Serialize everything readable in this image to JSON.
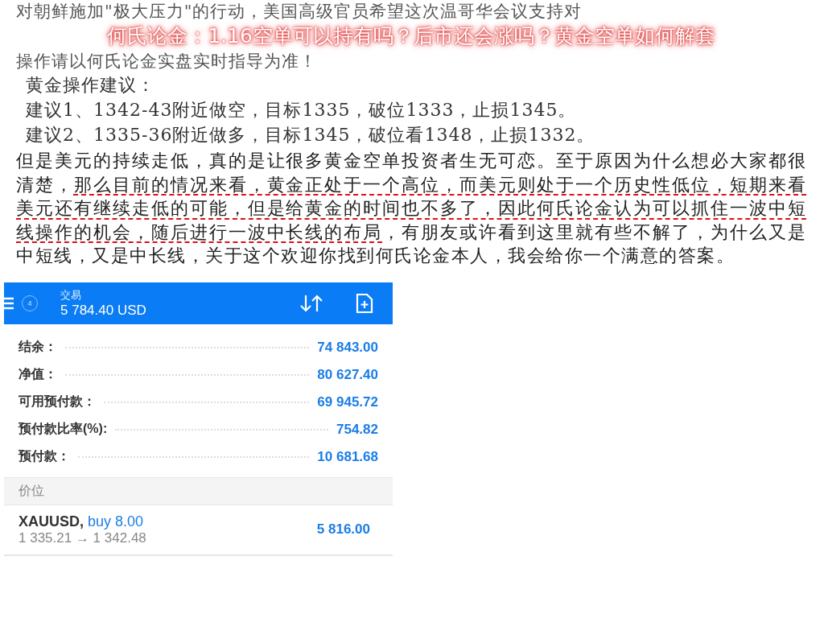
{
  "article": {
    "top_line": "对朝鲜施加\"极大压力\"的行动，美国高级官员希望这次温哥华会议支持对",
    "headline": "何氏论金：1.16空单可以持有吗？后市还会涨吗？黄金空单如何解套",
    "notice_line": "操作请以何氏论金实盘实时指导为准！",
    "advice_title": "黄金操作建议：",
    "advice": [
      "建议1、1342-43附近做空，目标1335，破位1333，止损1345。",
      "建议2、1335-36附近做多，目标1345，破位看1348，止损1332。"
    ],
    "paragraph": [
      {
        "text": "但是美元的持续走低，真的是让很多黄金空单投资者生无可恋。至于原因为什么想必大家都很清楚，",
        "underlined": false
      },
      {
        "text": "那么目前的情况来看，黄金正处于一个高位，而美元则处于一个历史性低位，短期来看美元还有继续走低的可能，但是给黄金的时间也不多了，因此何氏论金认为可以抓住一波中短线操作的机会，随后进行一波中长线的布局",
        "underlined": true
      },
      {
        "text": "，有朋友或许看到这里就有些不解了，为什么又是中短线，又是中长线，关于这个欢迎你找到何氏论金本人，我会给你一个满意的答案。",
        "underlined": false
      }
    ]
  },
  "app": {
    "header": {
      "badge": "4",
      "title": "交易",
      "balance": "5 784.40 USD"
    },
    "summary": [
      {
        "label": "结余：",
        "value": "74 843.00"
      },
      {
        "label": "净值：",
        "value": "80 627.40"
      },
      {
        "label": "可用预付款：",
        "value": "69 945.72"
      },
      {
        "label": "预付款比率(%):",
        "value": "754.82"
      },
      {
        "label": "预付款：",
        "value": "10 681.68"
      }
    ],
    "section": "价位",
    "positions": [
      {
        "symbol": "XAUUSD,",
        "order": "buy 8.00",
        "prices": "1 335.21 → 1 342.48",
        "profit": "5 816.00"
      }
    ]
  }
}
